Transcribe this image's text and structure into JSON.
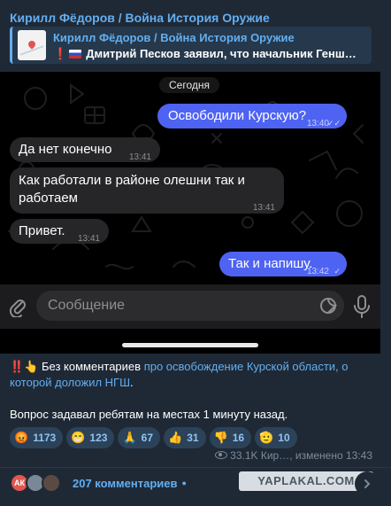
{
  "post": {
    "channel_name": "Кирилл Фёдоров / Война История Оружие",
    "forward": {
      "title": "Кирилл Фёдоров / Война История Оружие",
      "text_prefix": "❗",
      "text": "Дмитрий Песков заявил, что начальник Генш…"
    }
  },
  "chat": {
    "date_label": "Сегодня",
    "messages": [
      {
        "direction": "out",
        "text": "Освободили Курскую?",
        "time": "13:40",
        "read": true
      },
      {
        "direction": "in",
        "text": "Да нет конечно",
        "time": "13:41"
      },
      {
        "direction": "in",
        "text": "Как работали в районе олешни так и работаем",
        "time": "13:41"
      },
      {
        "direction": "in",
        "text": "Привет.",
        "time": "13:41"
      },
      {
        "direction": "out",
        "text": "Так и напишу.",
        "time": "13:42",
        "read": false
      }
    ],
    "composer": {
      "placeholder": "Сообщение"
    }
  },
  "caption": {
    "emoji": "‼️",
    "hand": "👆",
    "text_before": "Без комментариев ",
    "link": "про освобождение Курской области, о которой доложил НГШ",
    "text_after": ".",
    "line2": "Вопрос задавал ребятам на местах 1 минуту назад."
  },
  "reactions": [
    {
      "emoji": "😡",
      "count": "1173"
    },
    {
      "emoji": "😁",
      "count": "123"
    },
    {
      "emoji": "🙏",
      "count": "67"
    },
    {
      "emoji": "👍",
      "count": "31"
    },
    {
      "emoji": "👎",
      "count": "16"
    },
    {
      "emoji": "🫡",
      "count": "10"
    }
  ],
  "meta": {
    "views": "33.1K",
    "author": "Кир…",
    "edited": ", изменено 13:43"
  },
  "comments": {
    "avatar_initials": "АК",
    "label": "207 комментариев",
    "dot": "●"
  },
  "watermark": "YAPLAKAL.COM",
  "colors": {
    "accent": "#63aef0",
    "out_bubble": "#4e63f2",
    "in_bubble": "#262628",
    "background": "#1f2936"
  }
}
